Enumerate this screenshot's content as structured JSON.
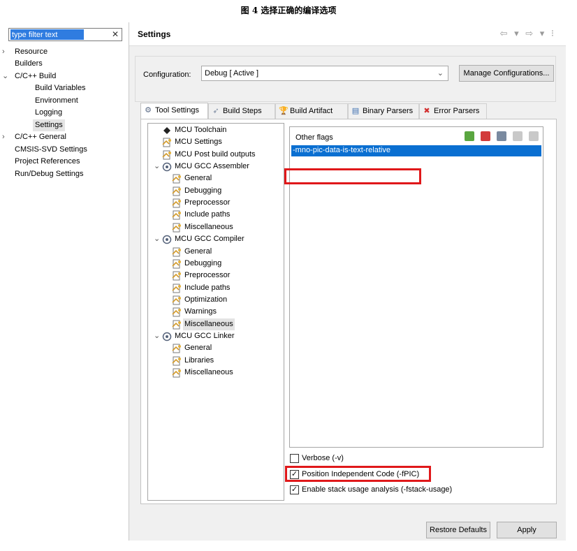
{
  "caption": "图 4 选择正确的编译选项",
  "filter": {
    "value": "type filter text",
    "clear_glyph": "✕"
  },
  "nav": {
    "items": [
      {
        "label": "Resource",
        "chevron": "›",
        "indent": 0
      },
      {
        "label": "Builders",
        "chevron": "",
        "indent": 0
      },
      {
        "label": "C/C++ Build",
        "chevron": "⌄",
        "indent": 0
      },
      {
        "label": "Build Variables",
        "chevron": "",
        "indent": 1
      },
      {
        "label": "Environment",
        "chevron": "",
        "indent": 1
      },
      {
        "label": "Logging",
        "chevron": "",
        "indent": 1
      },
      {
        "label": "Settings",
        "chevron": "",
        "indent": 1,
        "selected": true
      },
      {
        "label": "C/C++ General",
        "chevron": "›",
        "indent": 0
      },
      {
        "label": "CMSIS-SVD Settings",
        "chevron": "",
        "indent": 0
      },
      {
        "label": "Project References",
        "chevron": "",
        "indent": 0
      },
      {
        "label": "Run/Debug Settings",
        "chevron": "",
        "indent": 0
      }
    ]
  },
  "header": {
    "title": "Settings",
    "nav_glyphs": "⇦ ▾ ⇨ ▾ ⁝"
  },
  "config": {
    "label": "Configuration:",
    "selected": "Debug  [ Active ]",
    "manage_label": "Manage Configurations..."
  },
  "tabs": [
    {
      "label": "Tool Settings",
      "icon": "gear-icon",
      "glyph": "⚙",
      "active": true
    },
    {
      "label": "Build Steps",
      "icon": "build-steps-icon",
      "glyph": "➶",
      "active": false
    },
    {
      "label": "Build Artifact",
      "icon": "trophy-icon",
      "glyph": "🏆",
      "active": false
    },
    {
      "label": "Binary Parsers",
      "icon": "binary-icon",
      "glyph": "▤",
      "active": false
    },
    {
      "label": "Error Parsers",
      "icon": "error-icon",
      "glyph": "✖",
      "active": false
    }
  ],
  "tree": [
    {
      "label": "MCU Toolchain",
      "level": 0,
      "icon": "toolchain-icon",
      "chevron": ""
    },
    {
      "label": "MCU Settings",
      "level": 0,
      "icon": "settings-page-icon",
      "chevron": ""
    },
    {
      "label": "MCU Post build outputs",
      "level": 0,
      "icon": "settings-page-icon",
      "chevron": ""
    },
    {
      "label": "MCU GCC Assembler",
      "level": 0,
      "icon": "tool-icon",
      "chevron": "⌄"
    },
    {
      "label": "General",
      "level": 1,
      "icon": "settings-page-icon",
      "chevron": ""
    },
    {
      "label": "Debugging",
      "level": 1,
      "icon": "settings-page-icon",
      "chevron": ""
    },
    {
      "label": "Preprocessor",
      "level": 1,
      "icon": "settings-page-icon",
      "chevron": ""
    },
    {
      "label": "Include paths",
      "level": 1,
      "icon": "settings-page-icon",
      "chevron": ""
    },
    {
      "label": "Miscellaneous",
      "level": 1,
      "icon": "settings-page-icon",
      "chevron": ""
    },
    {
      "label": "MCU GCC Compiler",
      "level": 0,
      "icon": "tool-icon",
      "chevron": "⌄"
    },
    {
      "label": "General",
      "level": 1,
      "icon": "settings-page-icon",
      "chevron": ""
    },
    {
      "label": "Debugging",
      "level": 1,
      "icon": "settings-page-icon",
      "chevron": ""
    },
    {
      "label": "Preprocessor",
      "level": 1,
      "icon": "settings-page-icon",
      "chevron": ""
    },
    {
      "label": "Include paths",
      "level": 1,
      "icon": "settings-page-icon",
      "chevron": ""
    },
    {
      "label": "Optimization",
      "level": 1,
      "icon": "settings-page-icon",
      "chevron": ""
    },
    {
      "label": "Warnings",
      "level": 1,
      "icon": "settings-page-icon",
      "chevron": ""
    },
    {
      "label": "Miscellaneous",
      "level": 1,
      "icon": "settings-page-icon",
      "chevron": "",
      "selected": true
    },
    {
      "label": "MCU GCC Linker",
      "level": 0,
      "icon": "tool-icon",
      "chevron": "⌄"
    },
    {
      "label": "General",
      "level": 1,
      "icon": "settings-page-icon",
      "chevron": ""
    },
    {
      "label": "Libraries",
      "level": 1,
      "icon": "settings-page-icon",
      "chevron": ""
    },
    {
      "label": "Miscellaneous",
      "level": 1,
      "icon": "settings-page-icon",
      "chevron": ""
    }
  ],
  "flags": {
    "title": "Other flags",
    "items": [
      "-mno-pic-data-is-text-relative"
    ],
    "tools": [
      "add-icon",
      "delete-icon",
      "edit-icon",
      "move-up-icon",
      "move-down-icon"
    ]
  },
  "options": [
    {
      "label": "Verbose (-v)",
      "checked": false
    },
    {
      "label": "Position Independent Code (-fPIC)",
      "checked": true
    },
    {
      "label": "Enable stack usage analysis (-fstack-usage)",
      "checked": true
    }
  ],
  "footer": {
    "restore_label": "Restore Defaults",
    "apply_label": "Apply"
  },
  "colors": {
    "selection": "#0a6fd1",
    "highlight_box": "#e0181a",
    "panel_bg": "#f0f0f0"
  }
}
